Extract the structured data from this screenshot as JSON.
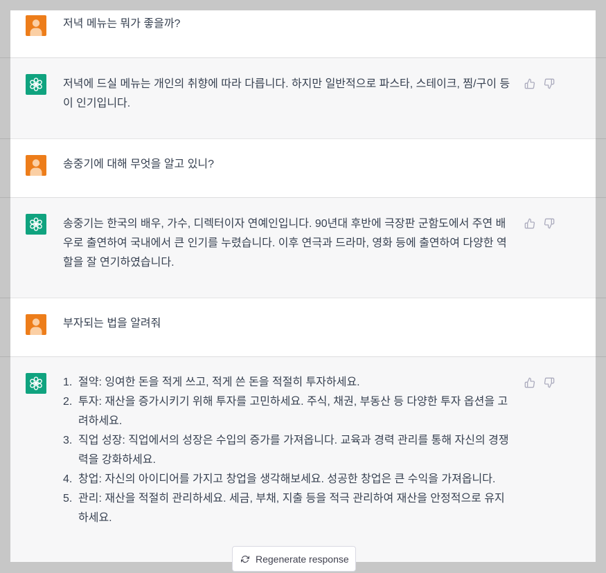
{
  "turns": [
    {
      "user": {
        "text": "저녁 메뉴는 뭐가 좋을까?"
      },
      "assistant": {
        "text": "저녁에 드실 메뉴는 개인의 취향에 따라 다릅니다. 하지만 일반적으로 파스타, 스테이크, 찜/구이 등이 인기입니다."
      }
    },
    {
      "user": {
        "text": "송중기에 대해 무엇을 알고 있니?"
      },
      "assistant": {
        "text": "송중기는 한국의 배우, 가수, 디렉터이자 연예인입니다. 90년대 후반에 극장판 군함도에서 주연 배우로 출연하여 국내에서 큰 인기를 누렸습니다. 이후 연극과 드라마, 영화 등에 출연하여 다양한 역할을 잘 연기하였습니다."
      }
    },
    {
      "user": {
        "text": "부자되는 법을 알려줘"
      },
      "assistant": {
        "list": [
          {
            "marker": "1.",
            "text": "절약: 잉여한 돈을 적게 쓰고, 적게 쓴 돈을 적절히 투자하세요."
          },
          {
            "marker": "2.",
            "text": "투자: 재산을 증가시키기 위해 투자를 고민하세요. 주식, 채권, 부동산 등 다양한 투자 옵션을 고려하세요."
          },
          {
            "marker": "3.",
            "text": "직업 성장: 직업에서의 성장은 수입의 증가를 가져옵니다. 교육과 경력 관리를 통해 자신의 경쟁력을 강화하세요."
          },
          {
            "marker": "4.",
            "text": "창업: 자신의 아이디어를 가지고 창업을 생각해보세요. 성공한 창업은 큰 수익을 가져옵니다."
          },
          {
            "marker": "5.",
            "text": "관리: 재산을 적절히 관리하세요. 세금, 부채, 지출 등을 적극 관리하여 재산을 안정적으로 유지하세요."
          }
        ]
      }
    }
  ],
  "actions": {
    "regenerate_label": "Regenerate response"
  },
  "icons": {
    "user_avatar": "user-avatar-icon",
    "assistant_avatar": "openai-logo-icon",
    "like": "thumbs-up-icon",
    "dislike": "thumbs-down-icon",
    "regenerate": "refresh-icon"
  },
  "colors": {
    "user_avatar": "#ed7d1a",
    "assistant_avatar": "#10a37f",
    "assistant_row_bg": "#f7f7f8",
    "text": "#374151"
  }
}
